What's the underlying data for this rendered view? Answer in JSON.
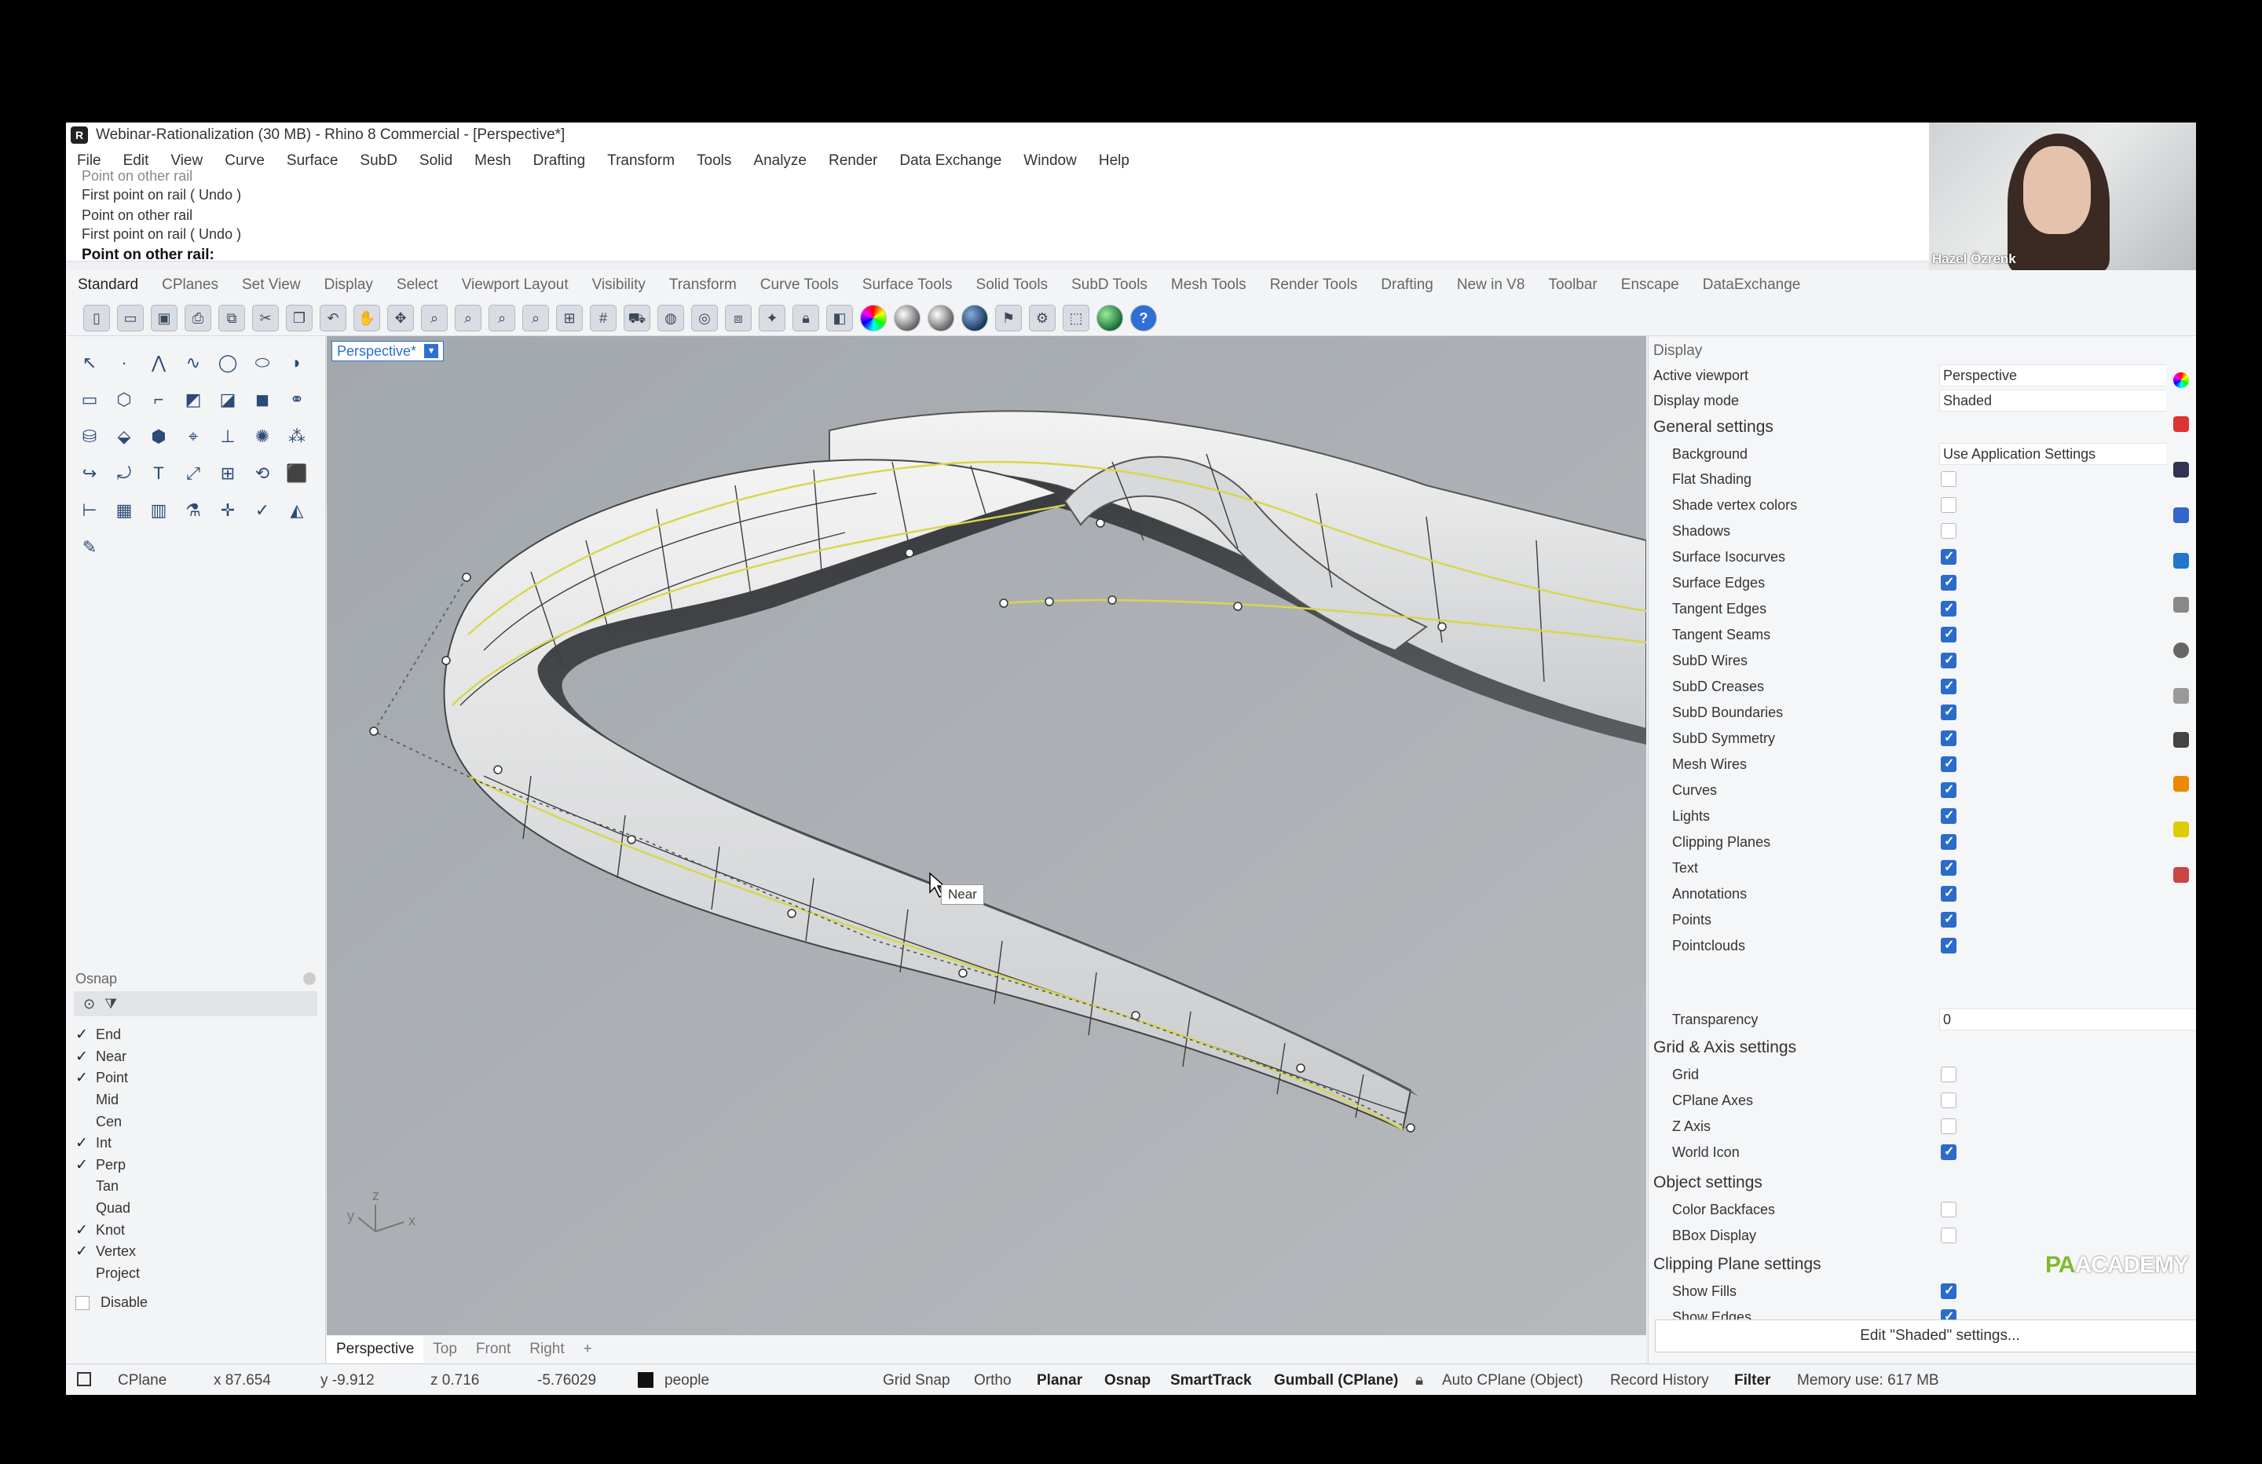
{
  "window": {
    "title": "Webinar-Rationalization (30 MB) - Rhino 8 Commercial - [Perspective*]"
  },
  "menu": [
    "File",
    "Edit",
    "View",
    "Curve",
    "Surface",
    "SubD",
    "Solid",
    "Mesh",
    "Drafting",
    "Transform",
    "Tools",
    "Analyze",
    "Render",
    "Data Exchange",
    "Window",
    "Help"
  ],
  "command_history": [
    "Point on other rail",
    "First point on rail ( Undo )",
    "Point on other rail",
    "First point on rail ( Undo )"
  ],
  "command_prompt": "Point on other rail:",
  "webcam": {
    "name": "Hazel Özrenk"
  },
  "toolbar_tabs": [
    "Standard",
    "CPlanes",
    "Set View",
    "Display",
    "Select",
    "Viewport Layout",
    "Visibility",
    "Transform",
    "Curve Tools",
    "Surface Tools",
    "Solid Tools",
    "SubD Tools",
    "Mesh Tools",
    "Render Tools",
    "Drafting",
    "New in V8",
    "Toolbar",
    "Enscape",
    "DataExchange"
  ],
  "toolbar_icons": [
    "new-file-icon",
    "open-icon",
    "save-icon",
    "print-icon",
    "export-icon",
    "copy-icon",
    "paste-icon",
    "undo-icon",
    "pan-icon",
    "move-icon",
    "zoom-icon",
    "zoom-window-icon",
    "zoom-extents-icon",
    "zoom-selected-icon",
    "four-viewports-icon",
    "grid-icon",
    "car-icon",
    "camera-icon",
    "target-icon",
    "layer-icon",
    "light-icon",
    "lock-icon",
    "properties-icon",
    "color-wheel-icon",
    "sphere-icon",
    "render-icon",
    "environment-icon",
    "flag-icon",
    "options-gear-icon",
    "named-view-icon",
    "globe-icon",
    "help-icon"
  ],
  "osnap": {
    "title": "Osnap",
    "items": [
      {
        "label": "End",
        "checked": true
      },
      {
        "label": "Near",
        "checked": true
      },
      {
        "label": "Point",
        "checked": true
      },
      {
        "label": "Mid",
        "checked": false
      },
      {
        "label": "Cen",
        "checked": false
      },
      {
        "label": "Int",
        "checked": true
      },
      {
        "label": "Perp",
        "checked": true
      },
      {
        "label": "Tan",
        "checked": false
      },
      {
        "label": "Quad",
        "checked": false
      },
      {
        "label": "Knot",
        "checked": true
      },
      {
        "label": "Vertex",
        "checked": true
      },
      {
        "label": "Project",
        "checked": false
      }
    ],
    "disable_label": "Disable"
  },
  "viewport": {
    "title": "Perspective*",
    "tooltip": "Near",
    "axis": {
      "x": "x",
      "y": "y",
      "z": "z"
    },
    "tabs": [
      "Perspective",
      "Top",
      "Front",
      "Right"
    ],
    "add_tab": "+"
  },
  "display": {
    "header": "Display",
    "active_viewport_label": "Active viewport",
    "active_viewport_value": "Perspective",
    "display_mode_label": "Display mode",
    "display_mode_value": "Shaded",
    "general_title": "General settings",
    "background_label": "Background",
    "background_value": "Use Application Settings",
    "general": [
      {
        "label": "Flat Shading",
        "checked": false
      },
      {
        "label": "Shade vertex colors",
        "checked": false
      },
      {
        "label": "Shadows",
        "checked": false
      },
      {
        "label": "Surface Isocurves",
        "checked": true
      },
      {
        "label": "Surface Edges",
        "checked": true
      },
      {
        "label": "Tangent Edges",
        "checked": true
      },
      {
        "label": "Tangent Seams",
        "checked": true
      },
      {
        "label": "SubD Wires",
        "checked": true
      },
      {
        "label": "SubD Creases",
        "checked": true
      },
      {
        "label": "SubD Boundaries",
        "checked": true
      },
      {
        "label": "SubD Symmetry",
        "checked": true
      },
      {
        "label": "Mesh Wires",
        "checked": true
      },
      {
        "label": "Curves",
        "checked": true
      },
      {
        "label": "Lights",
        "checked": true
      },
      {
        "label": "Clipping Planes",
        "checked": true
      },
      {
        "label": "Text",
        "checked": true
      },
      {
        "label": "Annotations",
        "checked": true
      },
      {
        "label": "Points",
        "checked": true
      },
      {
        "label": "Pointclouds",
        "checked": true
      }
    ],
    "transparency_label": "Transparency",
    "transparency_value": "0",
    "grid_title": "Grid & Axis settings",
    "grid": [
      {
        "label": "Grid",
        "checked": false
      },
      {
        "label": "CPlane Axes",
        "checked": false
      },
      {
        "label": "Z Axis",
        "checked": false
      },
      {
        "label": "World Icon",
        "checked": true
      }
    ],
    "object_title": "Object settings",
    "object": [
      {
        "label": "Color Backfaces",
        "checked": false
      },
      {
        "label": "BBox Display",
        "checked": false
      }
    ],
    "clipping_title": "Clipping Plane settings",
    "clipping": [
      {
        "label": "Show Fills",
        "checked": true
      },
      {
        "label": "Show Edges",
        "checked": true
      }
    ],
    "edit_button": "Edit \"Shaded\" settings..."
  },
  "status": {
    "cplane": "CPlane",
    "x": "x 87.654",
    "y": "y -9.912",
    "z": "z 0.716",
    "distance": "-5.76029",
    "layer": "people",
    "grid_snap": "Grid Snap",
    "ortho": "Ortho",
    "planar": "Planar",
    "osnap": "Osnap",
    "smarttrack": "SmartTrack",
    "gumball": "Gumball (CPlane)",
    "auto_cplane": "Auto CPlane (Object)",
    "record_history": "Record History",
    "filter": "Filter",
    "memory": "Memory use: 617 MB",
    "layer_color": "#111111"
  },
  "brand": {
    "pa": "PA",
    "academy": "ACADEMY"
  },
  "colors": {
    "accent": "#2b6bc9",
    "viewport_bg": "#a9adb1",
    "isocurve": "#d8d64a",
    "brand_green": "#7dbb2f"
  }
}
